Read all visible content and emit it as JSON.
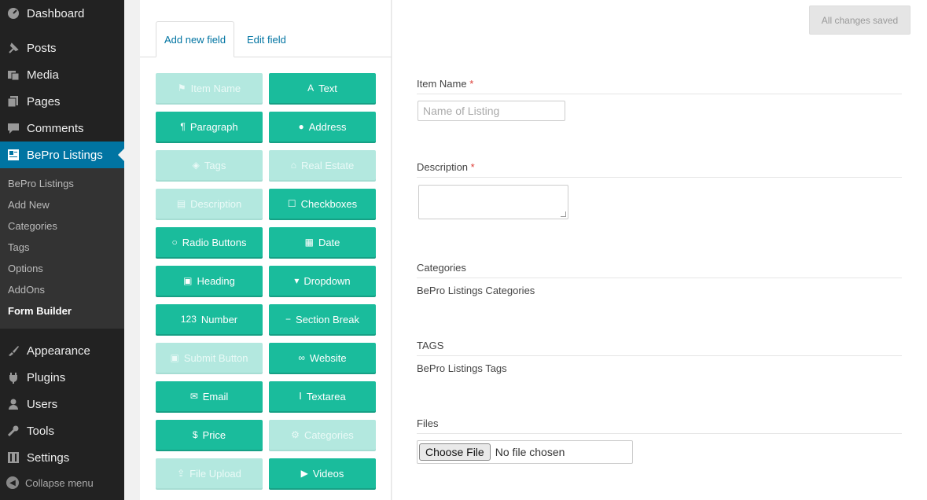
{
  "sidebar": {
    "menu": [
      {
        "label": "Dashboard",
        "icon": "dashboard-icon"
      },
      {
        "label": "Posts",
        "icon": "pin-icon"
      },
      {
        "label": "Media",
        "icon": "media-icon"
      },
      {
        "label": "Pages",
        "icon": "pages-icon"
      },
      {
        "label": "Comments",
        "icon": "comment-icon"
      },
      {
        "label": "BePro Listings",
        "icon": "listings-icon"
      }
    ],
    "submenu": [
      "BePro Listings",
      "Add New",
      "Categories",
      "Tags",
      "Options",
      "AddOns",
      "Form Builder"
    ],
    "menu2": [
      {
        "label": "Appearance",
        "icon": "brush-icon"
      },
      {
        "label": "Plugins",
        "icon": "plugin-icon"
      },
      {
        "label": "Users",
        "icon": "user-icon"
      },
      {
        "label": "Tools",
        "icon": "wrench-icon"
      },
      {
        "label": "Settings",
        "icon": "settings-icon"
      }
    ],
    "collapse": "Collapse menu"
  },
  "builder": {
    "tabs": [
      "Add new field",
      "Edit field"
    ],
    "buttons": [
      {
        "label": "Item Name",
        "icon": "bookmark-icon",
        "disabled": true
      },
      {
        "label": "Text",
        "icon": "font-icon",
        "disabled": false
      },
      {
        "label": "Paragraph",
        "icon": "paragraph-icon",
        "disabled": false
      },
      {
        "label": "Address",
        "icon": "map-marker-icon",
        "disabled": false
      },
      {
        "label": "Tags",
        "icon": "tags-icon",
        "disabled": true
      },
      {
        "label": "Real Estate",
        "icon": "home-icon",
        "disabled": true
      },
      {
        "label": "Description",
        "icon": "book-icon",
        "disabled": true
      },
      {
        "label": "Checkboxes",
        "icon": "checkbox-icon",
        "disabled": false
      },
      {
        "label": "Radio Buttons",
        "icon": "radio-icon",
        "disabled": false
      },
      {
        "label": "Date",
        "icon": "calendar-icon",
        "disabled": false
      },
      {
        "label": "Heading",
        "icon": "heading-icon",
        "disabled": false
      },
      {
        "label": "Dropdown",
        "icon": "caret-down-icon",
        "disabled": false
      },
      {
        "label": "Number",
        "icon": "number-icon",
        "disabled": false
      },
      {
        "label": "Section Break",
        "icon": "minus-icon",
        "disabled": false
      },
      {
        "label": "Submit Button",
        "icon": "save-icon",
        "disabled": true
      },
      {
        "label": "Website",
        "icon": "link-icon",
        "disabled": false
      },
      {
        "label": "Email",
        "icon": "envelope-icon",
        "disabled": false
      },
      {
        "label": "Textarea",
        "icon": "text-height-icon",
        "disabled": false
      },
      {
        "label": "Price",
        "icon": "dollar-icon",
        "disabled": false
      },
      {
        "label": "Categories",
        "icon": "cogs-icon",
        "disabled": true
      },
      {
        "label": "File Upload",
        "icon": "upload-icon",
        "disabled": true
      },
      {
        "label": "Videos",
        "icon": "video-icon",
        "disabled": false
      }
    ]
  },
  "preview": {
    "saved": "All changes saved",
    "item_name_label": "Item Name",
    "required_mark": "*",
    "item_name_placeholder": "Name of Listing",
    "description_label": "Description",
    "categories_label": "Categories",
    "categories_text": "BePro Listings Categories",
    "tags_label": "TAGS",
    "tags_text": "BePro Listings Tags",
    "files_label": "Files",
    "choose_file": "Choose File",
    "no_file": "No file chosen"
  }
}
